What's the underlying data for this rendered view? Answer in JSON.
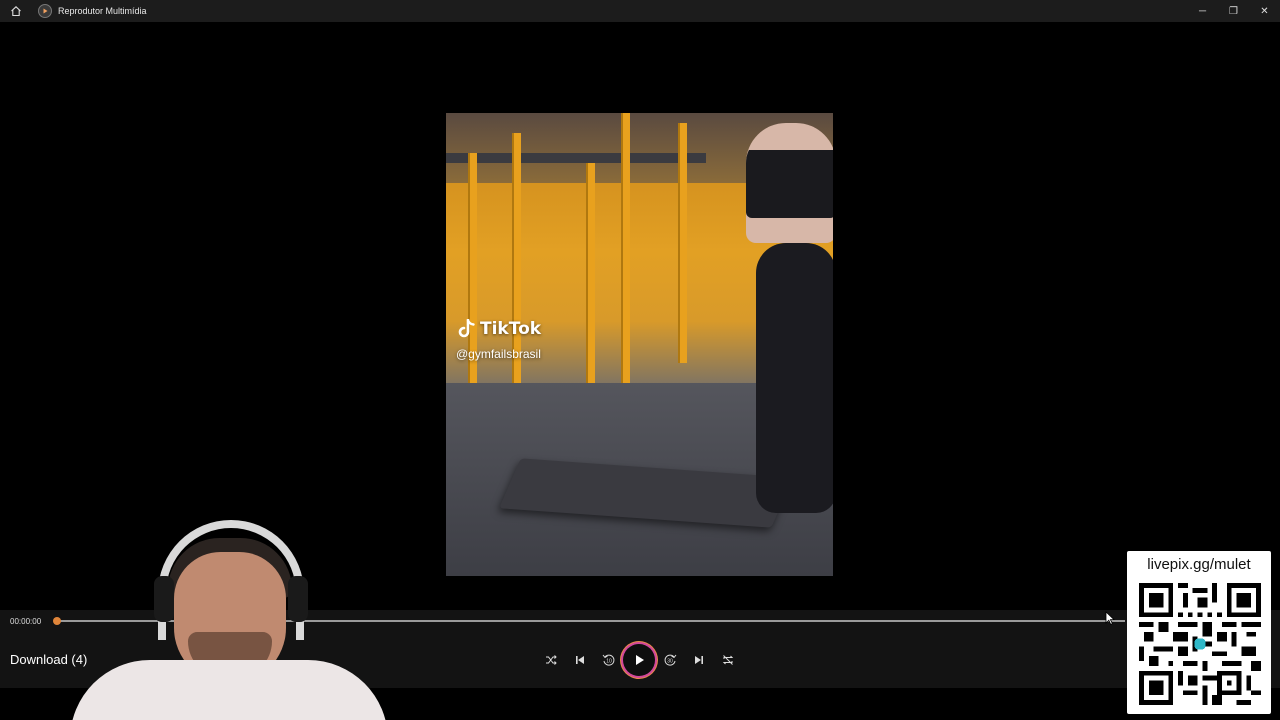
{
  "window": {
    "title": "Reprodutor Multimídia",
    "minimize": "─",
    "restore": "❐",
    "close": "✕"
  },
  "video": {
    "watermark_brand": "TikTok",
    "watermark_user": "@gymfailsbrasil"
  },
  "player": {
    "current_time": "00:00:00",
    "progress": 0.0,
    "media_title": "Download (4)"
  },
  "overlay": {
    "qr_url": "livepix.gg/mulet"
  },
  "icons": [
    "home-icon",
    "app-icon",
    "shuffle-icon",
    "previous-icon",
    "skip-back-10-icon",
    "play-icon",
    "skip-forward-30-icon",
    "next-icon",
    "repeat-off-icon"
  ],
  "colors": {
    "accent_thumb": "#e0853a",
    "play_ring_pink": "#d2479a",
    "play_ring_orange": "#e7894a"
  }
}
